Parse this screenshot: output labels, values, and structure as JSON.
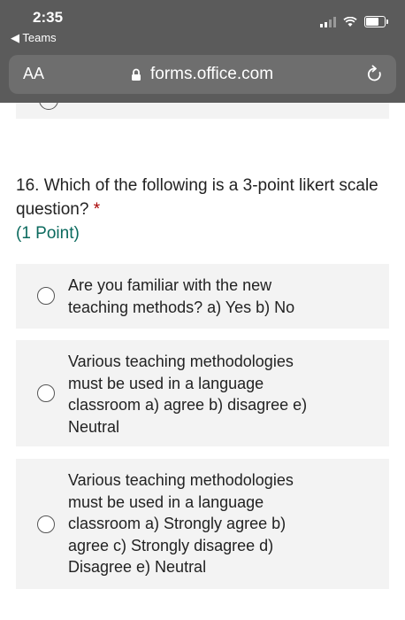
{
  "status_bar": {
    "time": "2:35",
    "back_app": "◀ Teams"
  },
  "browser": {
    "text_size_label": "AA",
    "url": "forms.office.com"
  },
  "question": {
    "number_and_text": "16. Which of the following is a 3-point likert scale question?",
    "required_marker": "*",
    "points": "(1 Point)",
    "options": [
      {
        "label": "Are you familiar with the new teaching methods? a) Yes b) No",
        "selected": false
      },
      {
        "label": "Various teaching methodologies must be used in a language classroom a) agree b) disagree e) Neutral",
        "selected": false
      },
      {
        "label": "Various teaching methodologies must be used in a language classroom a) Strongly agree b) agree c) Strongly disagree d) Disagree e) Neutral",
        "selected": false
      }
    ]
  }
}
